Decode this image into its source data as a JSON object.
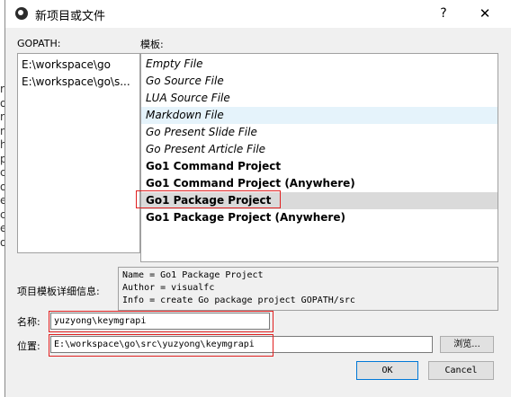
{
  "background_strip": [
    "r",
    "o",
    "r",
    "n",
    "h",
    "p",
    "ci",
    "o",
    "er",
    "c",
    "er",
    "o",
    "",
    ""
  ],
  "dialog": {
    "title": "新项目或文件",
    "help_label": "?",
    "close_label": "✕"
  },
  "gopath": {
    "label": "GOPATH:",
    "items": [
      "E:\\workspace\\go",
      "E:\\workspace\\go\\s..."
    ]
  },
  "templates": {
    "label": "模板:",
    "items": [
      {
        "label": "Empty File"
      },
      {
        "label": "Go Source File"
      },
      {
        "label": "LUA Source File"
      },
      {
        "label": "Markdown File"
      },
      {
        "label": "Go Present Slide File"
      },
      {
        "label": "Go Present Article File"
      },
      {
        "label": "Go1 Command Project"
      },
      {
        "label": "Go1 Command Project (Anywhere)"
      },
      {
        "label": "Go1 Package Project"
      },
      {
        "label": "Go1 Package Project (Anywhere)"
      }
    ],
    "selected_index": 8
  },
  "template_info": {
    "label": "项目模板详细信息:",
    "lines": [
      "Name = Go1 Package Project",
      "Author = visualfc",
      "Info = create Go package project GOPATH/src"
    ]
  },
  "form": {
    "name_label": "名称:",
    "name_value": "yuzyong\\keymgrapi",
    "location_label": "位置:",
    "location_value": "E:\\workspace\\go\\src\\yuzyong\\keymgrapi",
    "browse_label": "浏览..."
  },
  "buttons": {
    "ok": "OK",
    "cancel": "Cancel"
  }
}
